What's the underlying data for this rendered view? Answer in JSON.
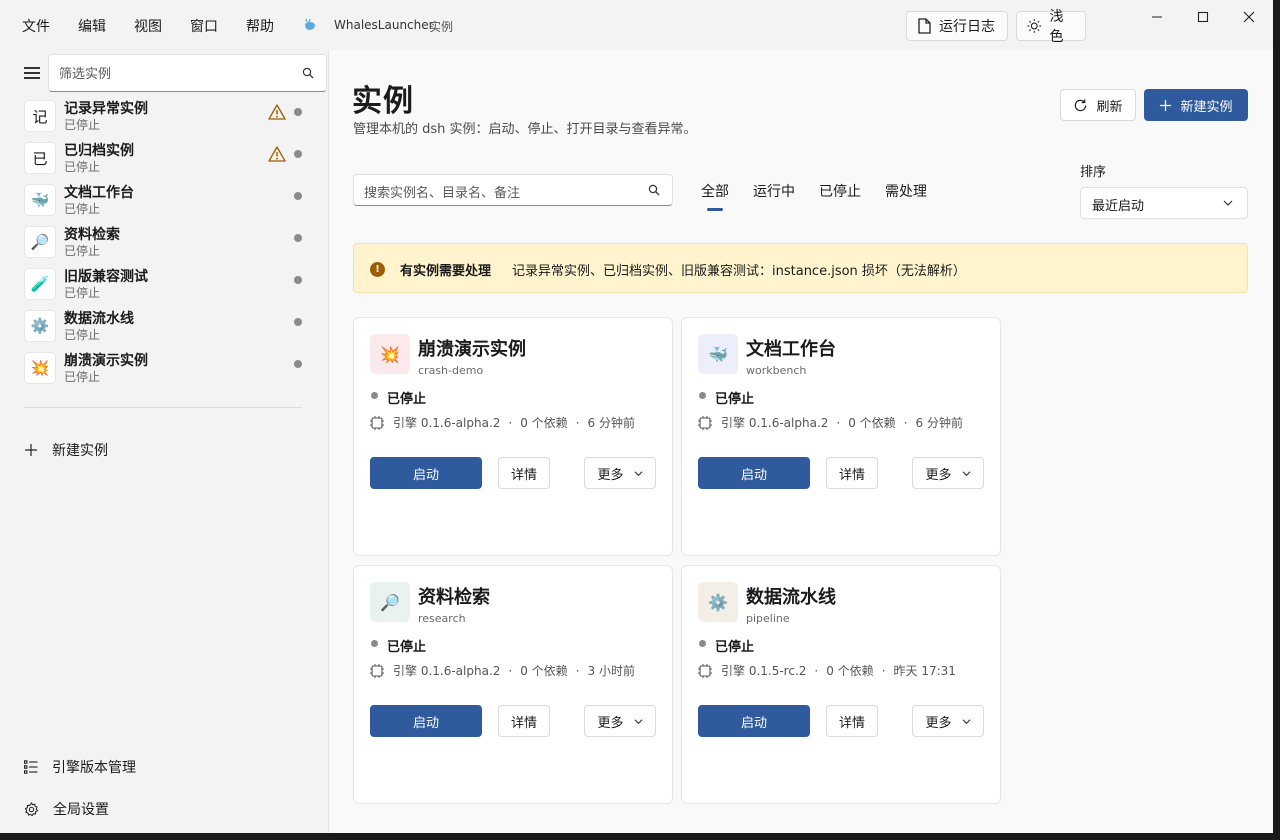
{
  "menu": [
    "文件",
    "编辑",
    "视图",
    "窗口",
    "帮助"
  ],
  "app": {
    "title": "WhalesLauncher",
    "subtitle": "实例"
  },
  "toolbar": {
    "log_label": "运行日志",
    "theme_label": "浅色"
  },
  "sidebar": {
    "filter_placeholder": "筛选实例",
    "items": [
      {
        "avatar": "记",
        "name": "记录异常实例",
        "status": "已停止",
        "warning": true
      },
      {
        "avatar": "已",
        "name": "已归档实例",
        "status": "已停止",
        "warning": true
      },
      {
        "avatar": "🐳",
        "name": "文档工作台",
        "status": "已停止",
        "warning": false
      },
      {
        "avatar": "🔎",
        "name": "资料检索",
        "status": "已停止",
        "warning": false
      },
      {
        "avatar": "🧪",
        "name": "旧版兼容测试",
        "status": "已停止",
        "warning": false
      },
      {
        "avatar": "⚙️",
        "name": "数据流水线",
        "status": "已停止",
        "warning": false
      },
      {
        "avatar": "💥",
        "name": "崩溃演示实例",
        "status": "已停止",
        "warning": false
      }
    ],
    "new_instance": "新建实例",
    "engine_mgmt": "引擎版本管理",
    "global_settings": "全局设置"
  },
  "main": {
    "title": "实例",
    "subtitle": "管理本机的 dsh 实例：启动、停止、打开目录与查看异常。",
    "refresh_label": "刷新",
    "new_label": "新建实例",
    "search_placeholder": "搜索实例名、目录名、备注",
    "tabs": [
      "全部",
      "运行中",
      "已停止",
      "需处理"
    ],
    "sort_label": "排序",
    "sort_value": "最近启动",
    "alert_title": "有实例需要处理",
    "alert_msg": "记录异常实例、已归档实例、旧版兼容测试：instance.json 损坏（无法解析）",
    "cards": [
      {
        "icon": "💥",
        "icon_bg": "#fbe9ec",
        "title": "崩溃演示实例",
        "slug": "crash-demo",
        "status": "已停止",
        "engine": "引擎 0.1.6-alpha.2",
        "deps": "0 个依赖",
        "time": "6 分钟前",
        "start": "启动",
        "detail": "详情",
        "more": "更多"
      },
      {
        "icon": "🐳",
        "icon_bg": "#eceffb",
        "title": "文档工作台",
        "slug": "workbench",
        "status": "已停止",
        "engine": "引擎 0.1.6-alpha.2",
        "deps": "0 个依赖",
        "time": "6 分钟前",
        "start": "启动",
        "detail": "详情",
        "more": "更多"
      },
      {
        "icon": "🔎",
        "icon_bg": "#e8f2ef",
        "title": "资料检索",
        "slug": "research",
        "status": "已停止",
        "engine": "引擎 0.1.6-alpha.2",
        "deps": "0 个依赖",
        "time": "3 小时前",
        "start": "启动",
        "detail": "详情",
        "more": "更多"
      },
      {
        "icon": "⚙️",
        "icon_bg": "#f4efe6",
        "title": "数据流水线",
        "slug": "pipeline",
        "status": "已停止",
        "engine": "引擎 0.1.5-rc.2",
        "deps": "0 个依赖",
        "time": "昨天 17:31",
        "start": "启动",
        "detail": "详情",
        "more": "更多"
      }
    ]
  },
  "colors": {
    "accent": "#2f5a9e",
    "warning_bg": "#fff4ce",
    "warning_icon": "#9d5d00"
  }
}
